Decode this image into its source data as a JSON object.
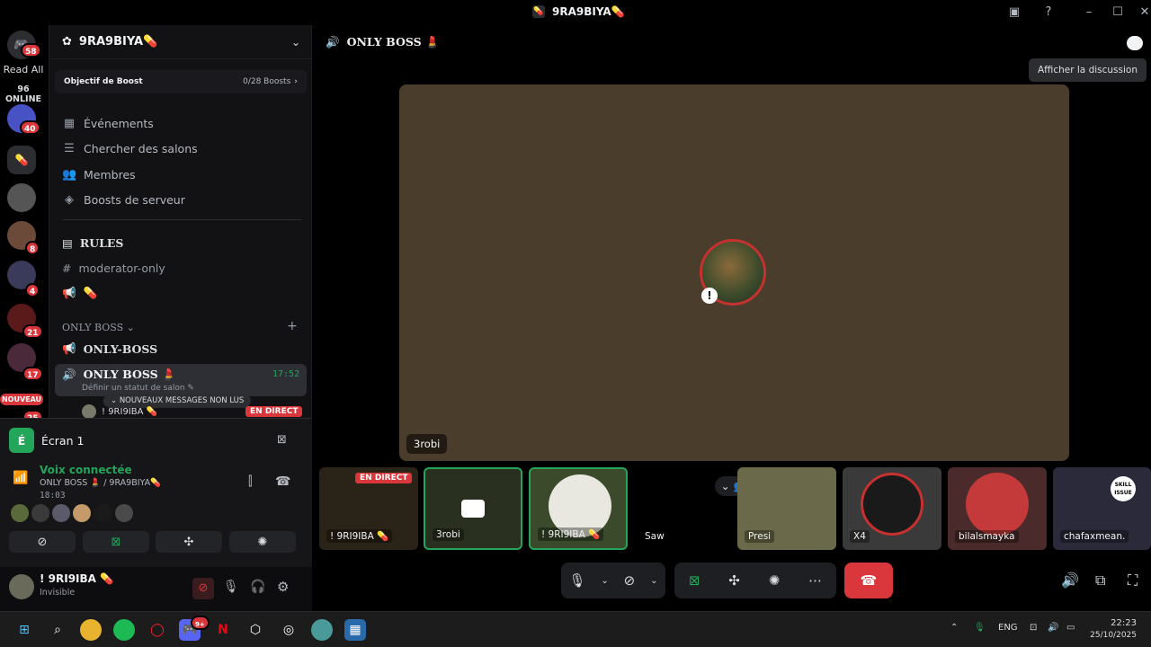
{
  "window": {
    "title": "9RA9BIYA💊"
  },
  "rail": {
    "home_badge": "58",
    "read_all": "Read All",
    "online": "96 ONLINE",
    "badges": [
      "40",
      "8",
      "4",
      "21",
      "17"
    ],
    "nouveau": "NOUVEAU",
    "nouveau_badge": "25"
  },
  "sidebar": {
    "guild_name": "9RA9BIYA💊",
    "boost_goal": "Objectif de Boost",
    "boost_count": "0/28 Boosts",
    "nav": [
      "Événements",
      "Chercher des salons",
      "Membres",
      "Boosts de serveur"
    ],
    "channels": {
      "rules": "RULES",
      "moderator": "moderator-only",
      "pill_channel": "💊",
      "category": "ONLY BOSS",
      "only_boss_text": "ONLY-BOSS",
      "active_voice": "ONLY BOSS 💄",
      "active_time": "17:52",
      "active_status": "Définir un statut de salon ✎",
      "unread_pill": "NOUVEAUX MESSAGES NON LUS",
      "live_user": "! 9RI9IBA 💊",
      "en_direct": "EN DIRECT"
    }
  },
  "screen_panel": {
    "title": "Écran 1",
    "voice_connected": "Voix connectée",
    "voice_channel": "ONLY BOSS 💄 / 9RA9BIYA💊",
    "voice_time": "18:03"
  },
  "user": {
    "name": "! 9RI9IBA 💊",
    "status": "Invisible"
  },
  "main": {
    "channel_title": "ONLY BOSS 💄",
    "tooltip": "Afficher la discussion",
    "stage_name": "3robi",
    "tiles": [
      {
        "name": "! 9RI9IBA 💊",
        "badge": "EN DIRECT"
      },
      {
        "name": "3robi"
      },
      {
        "name": "! 9RI9IBA 💊"
      },
      {
        "name": "Saw"
      },
      {
        "name": "Presi"
      },
      {
        "name": "X4"
      },
      {
        "name": "bilalsmayka"
      },
      {
        "name": "chafaxmean."
      }
    ],
    "skill_issue": "SKILL ISSUE"
  },
  "taskbar": {
    "lang": "ENG",
    "time": "22:23",
    "date": "25/10/2025",
    "discord_badge": "9+"
  }
}
